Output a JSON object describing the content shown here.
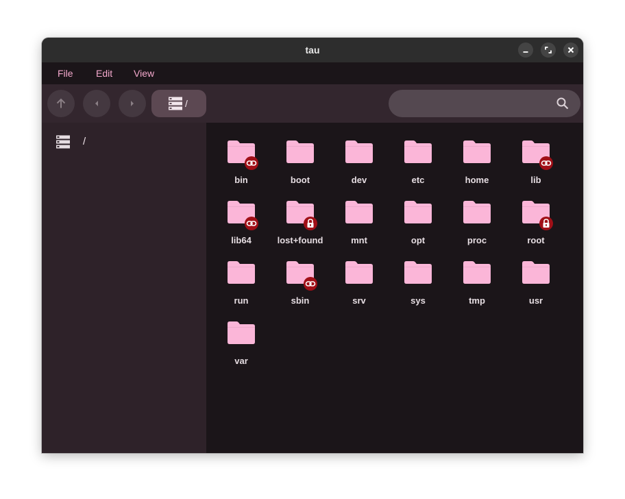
{
  "window": {
    "title": "tau"
  },
  "menu": {
    "file": "File",
    "edit": "Edit",
    "view": "View"
  },
  "toolbar": {
    "path_label": "/",
    "search": {
      "value": "",
      "placeholder": ""
    }
  },
  "sidebar": {
    "items": [
      {
        "label": "/",
        "icon": "drive-icon"
      }
    ]
  },
  "colors": {
    "accent": "#f5a9cd",
    "folder": "#fbb6d8",
    "emblem": "#a00f17",
    "titlebar": "#2d2d2d",
    "toolbar": "#33262e",
    "sidebar": "#2e2229",
    "content": "#1b1519"
  },
  "files": [
    {
      "name": "bin",
      "emblem": "link"
    },
    {
      "name": "boot",
      "emblem": ""
    },
    {
      "name": "dev",
      "emblem": ""
    },
    {
      "name": "etc",
      "emblem": ""
    },
    {
      "name": "home",
      "emblem": ""
    },
    {
      "name": "lib",
      "emblem": "link"
    },
    {
      "name": "lib64",
      "emblem": "link"
    },
    {
      "name": "lost+found",
      "emblem": "lock"
    },
    {
      "name": "mnt",
      "emblem": ""
    },
    {
      "name": "opt",
      "emblem": ""
    },
    {
      "name": "proc",
      "emblem": ""
    },
    {
      "name": "root",
      "emblem": "lock"
    },
    {
      "name": "run",
      "emblem": ""
    },
    {
      "name": "sbin",
      "emblem": "link"
    },
    {
      "name": "srv",
      "emblem": ""
    },
    {
      "name": "sys",
      "emblem": ""
    },
    {
      "name": "tmp",
      "emblem": ""
    },
    {
      "name": "usr",
      "emblem": ""
    },
    {
      "name": "var",
      "emblem": ""
    }
  ]
}
